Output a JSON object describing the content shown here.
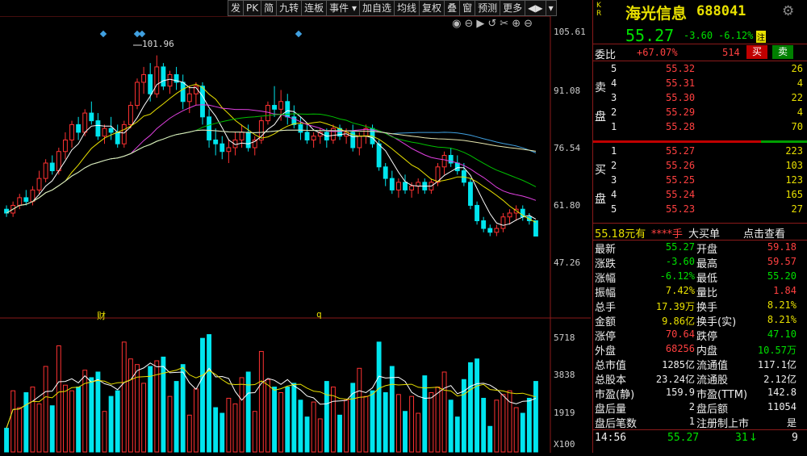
{
  "toolbar": {
    "items": [
      "发",
      "PK",
      "简",
      "九转",
      "连板",
      "事件 ▾",
      "加自选",
      "均线",
      "复权",
      "叠",
      "窗",
      "预测",
      "更多",
      "◀▶",
      "▾"
    ]
  },
  "icons": {
    "eye": "◉",
    "minus": "⊖",
    "play": "▶",
    "undo": "↺",
    "scissors": "✂",
    "zoom_in": "⊕",
    "zoom_out": "⊖"
  },
  "chart": {
    "price_axis": [
      "105.61",
      "91.08",
      "76.54",
      "61.80",
      "47.26"
    ],
    "volume_axis": [
      "5718",
      "3838",
      "1919",
      "X100"
    ],
    "peak_label": "101.96",
    "markers": [
      "财",
      "q"
    ]
  },
  "colors": {
    "up": "#ff3232",
    "down": "#00e5ee",
    "ma5": "#ffffff",
    "ma10": "#e8e000",
    "ma20": "#e040e0",
    "ma30": "#00c000",
    "ma60": "#40a0e0",
    "ma120": "#e8e8b0"
  },
  "stock": {
    "kr": "K\nR",
    "name": "海光信息",
    "code": "688041",
    "price": "55.27",
    "change": "-3.60",
    "pct": "-6.12%",
    "tag": "注",
    "weibi_label": "委比",
    "weibi_pct": "+67.07%",
    "weibi_num": "514",
    "buy_btn": "买",
    "sell_btn": "卖"
  },
  "asks": [
    {
      "lvl": "5",
      "price": "55.32",
      "vol": "26"
    },
    {
      "lvl": "4",
      "price": "55.31",
      "vol": "4"
    },
    {
      "lvl": "3",
      "price": "55.30",
      "vol": "22"
    },
    {
      "lvl": "2",
      "price": "55.29",
      "vol": "4"
    },
    {
      "lvl": "1",
      "price": "55.28",
      "vol": "70"
    }
  ],
  "ask_side": [
    "卖",
    "盘"
  ],
  "bids": [
    {
      "lvl": "1",
      "price": "55.27",
      "vol": "223"
    },
    {
      "lvl": "2",
      "price": "55.26",
      "vol": "103"
    },
    {
      "lvl": "3",
      "price": "55.25",
      "vol": "123"
    },
    {
      "lvl": "4",
      "price": "55.24",
      "vol": "165"
    },
    {
      "lvl": "5",
      "price": "55.23",
      "vol": "27"
    }
  ],
  "bid_side": [
    "买",
    "盘"
  ],
  "big_order": {
    "price": "55.18元有",
    "stars": "****手",
    "label": "大买单",
    "link": "点击查看"
  },
  "stats": [
    {
      "l1": "最新",
      "v1": "55.27",
      "c1": "green",
      "l2": "开盘",
      "v2": "59.18",
      "c2": "red"
    },
    {
      "l1": "涨跌",
      "v1": "-3.60",
      "c1": "green",
      "l2": "最高",
      "v2": "59.57",
      "c2": "red"
    },
    {
      "l1": "涨幅",
      "v1": "-6.12%",
      "c1": "green",
      "l2": "最低",
      "v2": "55.20",
      "c2": "green"
    },
    {
      "l1": "振幅",
      "v1": "7.42%",
      "c1": "yellow",
      "l2": "量比",
      "v2": "1.84",
      "c2": "red"
    },
    {
      "l1": "总手",
      "v1": "17.39万",
      "c1": "yellow",
      "l2": "换手",
      "v2": "8.21%",
      "c2": "yellow"
    },
    {
      "l1": "金额",
      "v1": "9.86亿",
      "c1": "yellow",
      "l2": "换手(实)",
      "v2": "8.21%",
      "c2": "yellow"
    },
    {
      "l1": "涨停",
      "v1": "70.64",
      "c1": "red",
      "l2": "跌停",
      "v2": "47.10",
      "c2": "green"
    },
    {
      "l1": "外盘",
      "v1": "68256",
      "c1": "red",
      "l2": "内盘",
      "v2": "10.57万",
      "c2": "green"
    },
    {
      "l1": "总市值",
      "v1": "1285亿",
      "c1": "white",
      "l2": "流通值",
      "v2": "117.1亿",
      "c2": "white"
    },
    {
      "l1": "总股本",
      "v1": "23.24亿",
      "c1": "white",
      "l2": "流通股",
      "v2": "2.12亿",
      "c2": "white"
    },
    {
      "l1": "市盈(静)",
      "v1": "159.9",
      "c1": "white",
      "l2": "市盈(TTM)",
      "v2": "142.8",
      "c2": "white"
    },
    {
      "l1": "盘后量",
      "v1": "2",
      "c1": "white",
      "l2": "盘后额",
      "v2": "11054",
      "c2": "white"
    },
    {
      "l1": "盘后笔数",
      "v1": "1",
      "c1": "white",
      "l2": "注册制上市",
      "v2": "是",
      "c2": "white"
    }
  ],
  "tick": {
    "time": "14:56",
    "price": "55.27",
    "vol": "31",
    "arrow": "↓",
    "num": "9"
  },
  "chart_data": {
    "type": "candlestick",
    "candles": [
      [
        62,
        63,
        60,
        61
      ],
      [
        61,
        64,
        60,
        63
      ],
      [
        63,
        66,
        62,
        65
      ],
      [
        65,
        67,
        63,
        64
      ],
      [
        64,
        68,
        63,
        67
      ],
      [
        67,
        72,
        66,
        70
      ],
      [
        70,
        75,
        69,
        74
      ],
      [
        74,
        76,
        71,
        72
      ],
      [
        72,
        78,
        71,
        77
      ],
      [
        77,
        82,
        75,
        80
      ],
      [
        80,
        85,
        78,
        84
      ],
      [
        84,
        86,
        80,
        82
      ],
      [
        82,
        88,
        81,
        87
      ],
      [
        87,
        90,
        84,
        85
      ],
      [
        85,
        87,
        80,
        81
      ],
      [
        81,
        84,
        79,
        83
      ],
      [
        83,
        86,
        80,
        82
      ],
      [
        82,
        84,
        78,
        79
      ],
      [
        79,
        85,
        78,
        84
      ],
      [
        84,
        90,
        83,
        89
      ],
      [
        89,
        96,
        88,
        95
      ],
      [
        95,
        99,
        92,
        97
      ],
      [
        97,
        100,
        90,
        92
      ],
      [
        92,
        102,
        91,
        99
      ],
      [
        99,
        100,
        93,
        94
      ],
      [
        94,
        98,
        92,
        97
      ],
      [
        97,
        99,
        93,
        95
      ],
      [
        95,
        97,
        88,
        90
      ],
      [
        90,
        94,
        87,
        92
      ],
      [
        92,
        95,
        89,
        94
      ],
      [
        94,
        95,
        84,
        86
      ],
      [
        86,
        88,
        78,
        80
      ],
      [
        80,
        83,
        76,
        79
      ],
      [
        79,
        81,
        75,
        77
      ],
      [
        77,
        80,
        74,
        78
      ],
      [
        78,
        82,
        76,
        80
      ],
      [
        80,
        84,
        78,
        82
      ],
      [
        82,
        84,
        77,
        78
      ],
      [
        78,
        81,
        76,
        80
      ],
      [
        80,
        86,
        79,
        85
      ],
      [
        85,
        90,
        84,
        89
      ],
      [
        89,
        94,
        86,
        88
      ],
      [
        88,
        93,
        85,
        90
      ],
      [
        90,
        92,
        84,
        86
      ],
      [
        86,
        89,
        83,
        84
      ],
      [
        84,
        86,
        80,
        82
      ],
      [
        82,
        84,
        79,
        80
      ],
      [
        80,
        82,
        78,
        81
      ],
      [
        81,
        83,
        79,
        82
      ],
      [
        82,
        83,
        78,
        80
      ],
      [
        80,
        84,
        79,
        83
      ],
      [
        83,
        84,
        80,
        81
      ],
      [
        81,
        83,
        79,
        82
      ],
      [
        82,
        84,
        77,
        78
      ],
      [
        78,
        82,
        76,
        81
      ],
      [
        81,
        84,
        79,
        83
      ],
      [
        83,
        84,
        78,
        79
      ],
      [
        79,
        80,
        72,
        73
      ],
      [
        73,
        74,
        68,
        70
      ],
      [
        70,
        72,
        66,
        67
      ],
      [
        67,
        70,
        65,
        69
      ],
      [
        69,
        71,
        66,
        67
      ],
      [
        67,
        69,
        65,
        68
      ],
      [
        68,
        70,
        66,
        69
      ],
      [
        69,
        70,
        66,
        67
      ],
      [
        67,
        70,
        66,
        69
      ],
      [
        69,
        74,
        68,
        73
      ],
      [
        73,
        77,
        71,
        76
      ],
      [
        76,
        78,
        73,
        74
      ],
      [
        74,
        76,
        71,
        72
      ],
      [
        72,
        74,
        68,
        69
      ],
      [
        69,
        70,
        62,
        63
      ],
      [
        63,
        64,
        58,
        59
      ],
      [
        59,
        60,
        56,
        57
      ],
      [
        57,
        58,
        55,
        56
      ],
      [
        56,
        58,
        55,
        57
      ],
      [
        57,
        61,
        56,
        60
      ],
      [
        60,
        62,
        58,
        61
      ],
      [
        61,
        63,
        59,
        62
      ],
      [
        62,
        63,
        59,
        60
      ],
      [
        60,
        61,
        58,
        59
      ],
      [
        59,
        59,
        55,
        55
      ]
    ]
  }
}
